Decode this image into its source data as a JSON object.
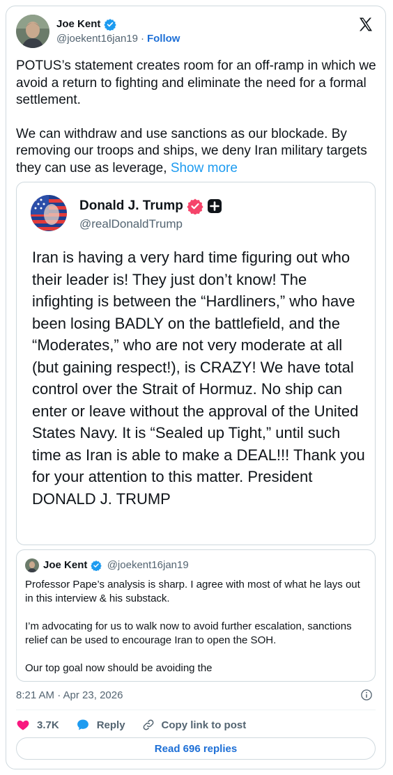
{
  "tweet": {
    "author": {
      "name": "Joe Kent",
      "handle": "@joekent16jan19",
      "separator": "·",
      "follow_label": "Follow"
    },
    "body": [
      "POTUS’s statement creates room for an off-ramp in which we avoid a return to fighting and eliminate the need for a formal settlement.",
      "We can withdraw and use sanctions as our blockade. By removing our troops and ships, we deny Iran military targets they can use as leverage,"
    ],
    "show_more_label": "Show more",
    "timestamp": "8:21 AM · Apr 23, 2026"
  },
  "quote_trump": {
    "name": "Donald J. Trump",
    "handle": "@realDonaldTrump",
    "text": "Iran is having a very hard time figuring out who their leader is! They just don’t know! The infighting is between the “Hardliners,” who have been losing BADLY on the battlefield, and the “Moderates,” who are not very moderate at all (but gaining respect!), is CRAZY! We have total control over the Strait of Hormuz. No ship can enter or leave without the approval of the United States Navy. It is “Sealed up Tight,” until such time as Iran is able to make a DEAL!!! Thank you for your attention to this matter. President DONALD J. TRUMP"
  },
  "quote_kent": {
    "name": "Joe Kent",
    "handle": "@joekent16jan19",
    "paragraphs": [
      "Professor Pape’s analysis is sharp. I agree with most of what he lays out in this interview & his substack.",
      "I’m advocating for us to walk now to avoid further escalation, sanctions relief can be used to encourage Iran to open the SOH.",
      "Our top goal now should be avoiding the"
    ]
  },
  "actions": {
    "likes": "3.7K",
    "reply_label": "Reply",
    "copy_link_label": "Copy link to post",
    "read_replies_label": "Read 696 replies"
  },
  "icons": {
    "brand": "x-logo-icon",
    "verified": "verified-badge-icon",
    "info": "info-icon",
    "like": "heart-icon",
    "reply": "reply-bubble-icon",
    "link": "link-icon"
  },
  "colors": {
    "accent": "#1d9bf0",
    "link": "#1d6fd6",
    "heart": "#f91880",
    "muted": "#536471",
    "border": "#cfd9de"
  }
}
